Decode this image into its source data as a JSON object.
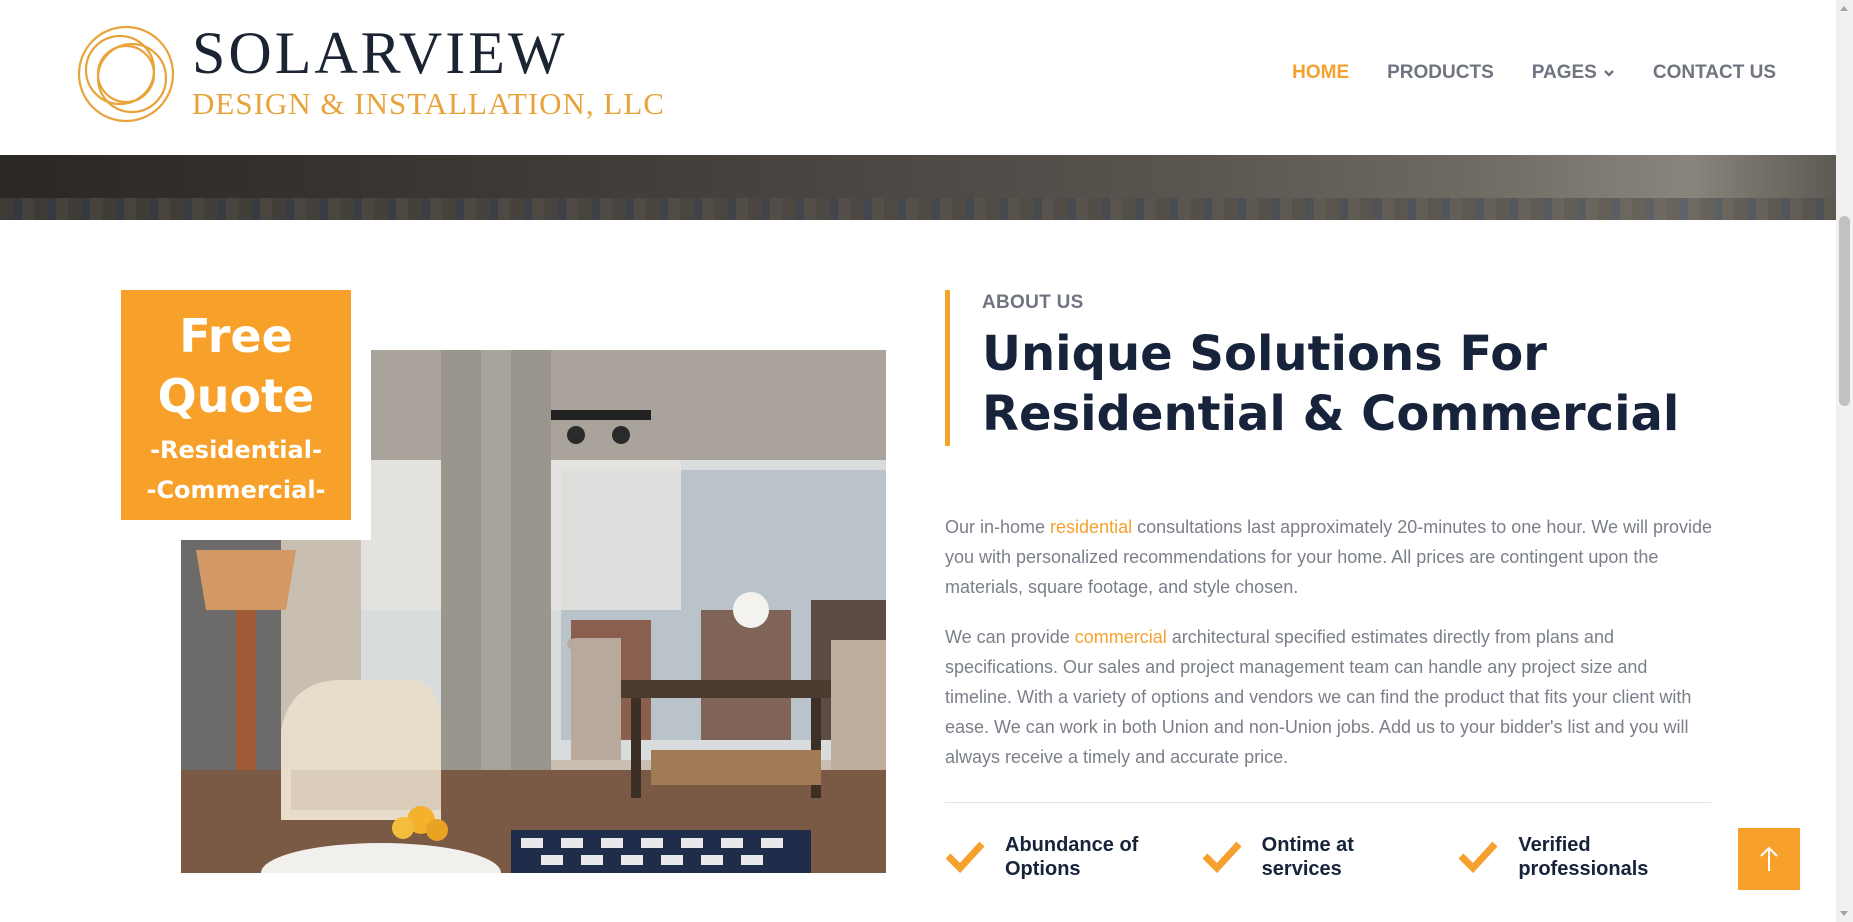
{
  "brand": {
    "name": "SOLARVIEW",
    "tagline": "DESIGN & INSTALLATION, LLC",
    "accent_color": "#F6A02D",
    "dark_color": "#17233A"
  },
  "nav": {
    "items": [
      {
        "label": "HOME",
        "active": true
      },
      {
        "label": "PRODUCTS",
        "active": false
      },
      {
        "label": "PAGES",
        "active": false,
        "has_dropdown": true
      },
      {
        "label": "CONTACT US",
        "active": false
      }
    ]
  },
  "quote_badge": {
    "line1": "Free",
    "line2": "Quote",
    "line3": "-Residential-",
    "line4": "-Commercial-"
  },
  "about": {
    "eyebrow": "ABOUT US",
    "headline_line1": "Unique Solutions For",
    "headline_line2": "Residential & Commercial",
    "p1_before": "Our in-home ",
    "p1_link": "residential",
    "p1_after": " consultations last approximately 20-minutes to one hour. We will provide you with personalized recommendations for your home. All prices are contingent upon the materials, square footage, and style chosen.",
    "p2_before": "We can provide ",
    "p2_link": "commercial",
    "p2_after": " architectural specified estimates directly from plans and specifications. Our sales and project management team can handle any project size and timeline. With a variety of options and vendors we can find the product that fits your client with ease. We can work in both Union and non-Union jobs. Add us to your bidder's list and you will always receive a timely and accurate price.",
    "features": [
      {
        "line1": "Abundance of",
        "line2": "Options",
        "icon": "check-icon"
      },
      {
        "line1": "Ontime at",
        "line2": "services",
        "icon": "check-icon"
      },
      {
        "line1": "Verified",
        "line2": "professionals",
        "icon": "check-icon"
      }
    ]
  },
  "back_to_top": {
    "icon": "arrow-up-icon"
  }
}
